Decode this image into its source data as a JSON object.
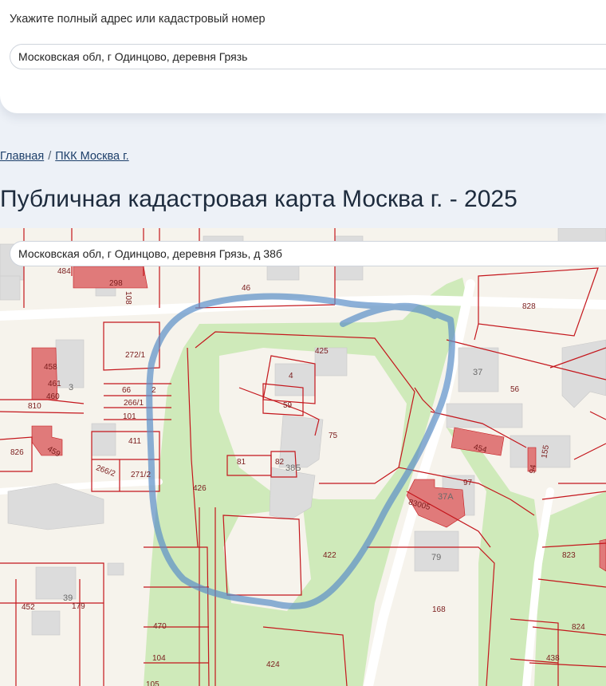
{
  "search": {
    "label": "Укажите полный адрес или кадастровый номер",
    "value": "Московская обл, г Одинцово, деревня Грязь"
  },
  "breadcrumb": {
    "home": "Главная",
    "separator": "/",
    "current": "ПКК Москва г."
  },
  "page_title": "Публичная кадастровая карта Москва г. - 2025",
  "map": {
    "search_value": "Московская обл, г Одинцово, деревня Грязь, д 38б",
    "colors": {
      "background": "#f6f3ec",
      "green": "#cfeaba",
      "building": "#dcdcdc",
      "highlighted_building": "#e07a7a",
      "parcel_border": "#c4161c",
      "route": "#5b8fc7"
    },
    "parcel_labels": [
      "484",
      "298",
      "108",
      "46",
      "828",
      "272/1",
      "425",
      "37",
      "458",
      "461",
      "460",
      "3",
      "66",
      "266/1",
      "810",
      "2",
      "101",
      "4",
      "59",
      "56",
      "75",
      "411",
      "826",
      "459",
      "266/2",
      "271/2",
      "81",
      "82",
      "38Б",
      "454",
      "94",
      "155",
      "426",
      "97",
      "37А",
      "83005",
      "422",
      "79",
      "823",
      "452",
      "179",
      "39",
      "168",
      "470",
      "824",
      "104",
      "424",
      "438",
      "105"
    ]
  }
}
